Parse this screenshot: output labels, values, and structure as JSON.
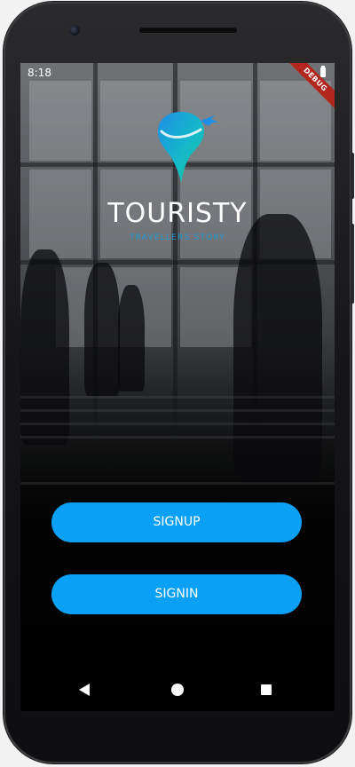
{
  "status_bar": {
    "time": "8:18",
    "battery_icon": "battery-icon"
  },
  "debug_banner": "DEBUG",
  "brand": {
    "logo_icon": "map-pin-plane-icon",
    "title": "TOURISTY",
    "subtitle": "TRAVELLERS STORY"
  },
  "buttons": {
    "signup_label": "SIGNUP",
    "signin_label": "SIGNIN"
  },
  "navigation": {
    "back_icon": "back-icon",
    "home_icon": "home-icon",
    "recents_icon": "recents-icon"
  },
  "colors": {
    "accent": "#0aa0f5",
    "subtitle": "#1f9ad6",
    "debug": "#b3261e"
  }
}
